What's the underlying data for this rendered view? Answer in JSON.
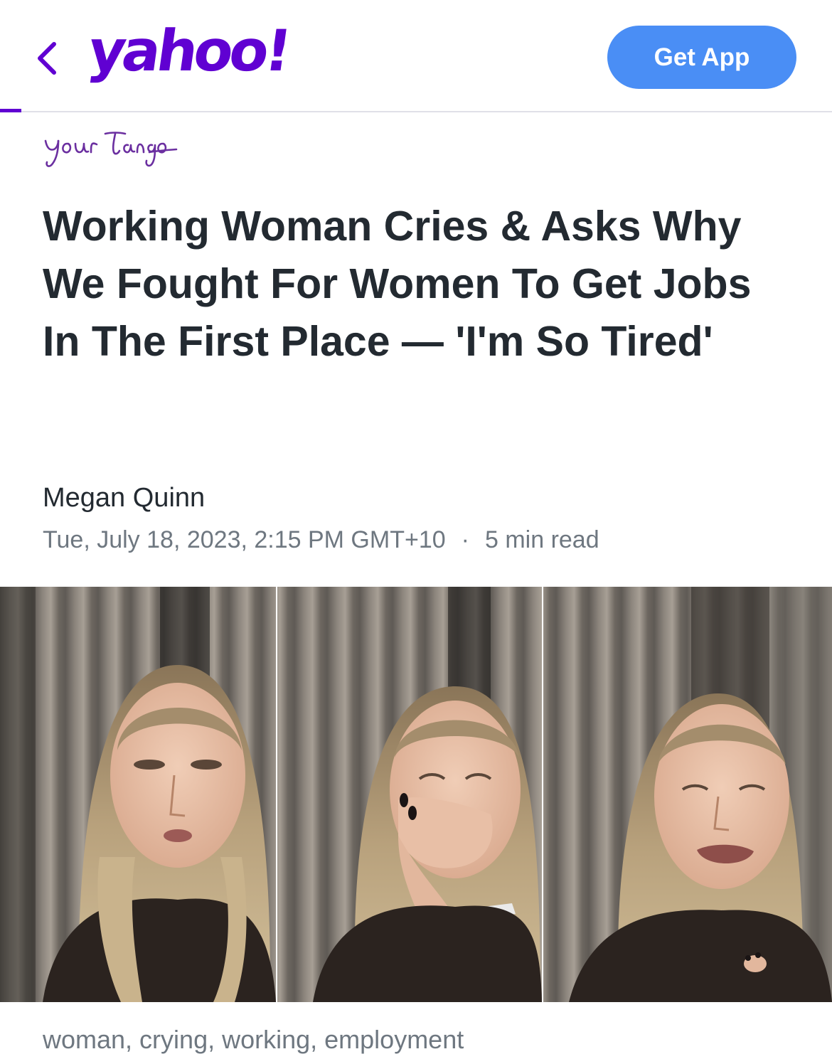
{
  "header": {
    "back_icon": "chevron-left-icon",
    "logo_text": "yahoo!",
    "get_app_label": "Get App",
    "brand_color": "#6001d2",
    "button_color": "#4a8ef5"
  },
  "article": {
    "provider_logo_text": "yourtango",
    "headline": "Working Woman Cries & Asks Why We Fought For Women To Get Jobs In The First Place — 'I'm So Tired'",
    "author": "Megan Quinn",
    "date": "Tue, July 18, 2023, 2:15 PM GMT+10",
    "separator": "·",
    "read_time": "5 min read",
    "image_caption": "woman, crying, working, employment"
  }
}
